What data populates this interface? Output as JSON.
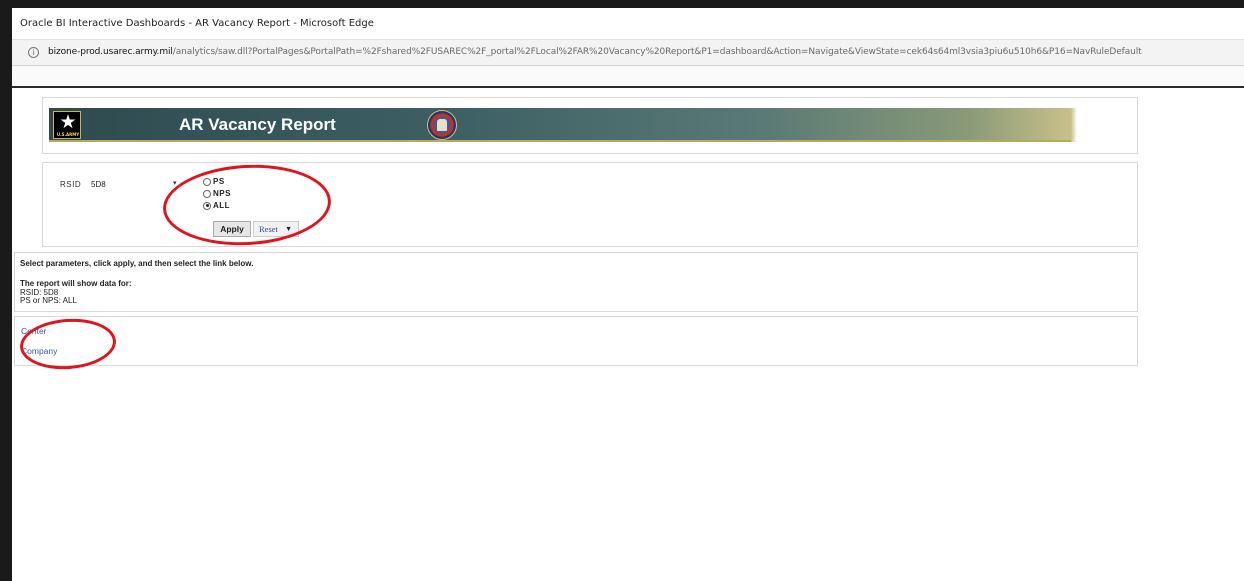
{
  "window": {
    "title": "Oracle BI Interactive Dashboards - AR Vacancy Report - Microsoft Edge"
  },
  "address_bar": {
    "info_icon": "i",
    "url_host": "bizone-prod.usarec.army.mil",
    "url_path": "/analytics/saw.dll?PortalPages&PortalPath=%2Fshared%2FUSAREC%2F_portal%2FLocal%2FAR%20Vacancy%20Report&P1=dashboard&Action=Navigate&ViewState=cek64s64ml3vsia3piu6u510h6&P16=NavRuleDefault"
  },
  "banner": {
    "title": "AR Vacancy Report",
    "logo_text": "U.S.ARMY",
    "logo_icon": "star-icon",
    "seal_icon": "usarec-seal-icon"
  },
  "prompt": {
    "rsid_label": "RSID",
    "rsid_value": "5D8",
    "radio_options": [
      {
        "label": "PS",
        "checked": false
      },
      {
        "label": "NPS",
        "checked": false
      },
      {
        "label": "ALL",
        "checked": true
      }
    ],
    "apply_label": "Apply",
    "reset_label": "Reset"
  },
  "info_text": {
    "instructions": "Select parameters, click apply, and then select the link below.",
    "show_for": "The report will show data for:",
    "rsid_line": "RSID: 5D8",
    "ps_line": "PS or NPS: ALL"
  },
  "links": {
    "center": "Center",
    "company": "Company"
  },
  "colors": {
    "annotation": "#e0141c",
    "link": "#2d5a9e",
    "banner_dark": "#2e4a4f",
    "banner_gold": "#c9c08a"
  }
}
